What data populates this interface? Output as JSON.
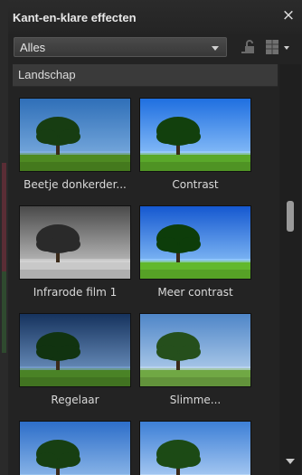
{
  "panel": {
    "title": "Kant-en-klare effecten",
    "close_symbol": "×"
  },
  "toolbar": {
    "category_value": "Alles",
    "icons": [
      "lock-icon",
      "grid-view-icon"
    ]
  },
  "section": {
    "title": "Landschap"
  },
  "effects": [
    {
      "label": "Beetje donkerder...",
      "style": "darker"
    },
    {
      "label": "Contrast",
      "style": "contrast"
    },
    {
      "label": "Infrarode film 1",
      "style": "infrared"
    },
    {
      "label": "Meer contrast",
      "style": "more"
    },
    {
      "label": "Regelaar",
      "style": "dark"
    },
    {
      "label": "Slimme...",
      "style": "soft"
    },
    {
      "label": "",
      "style": "sky"
    },
    {
      "label": "",
      "style": "bright"
    }
  ],
  "colors": {
    "panel_bg": "#232323",
    "section_bg": "#3a3a3a",
    "sky_blue": "#3f88d8",
    "grass_green": "#5a9a2a"
  }
}
